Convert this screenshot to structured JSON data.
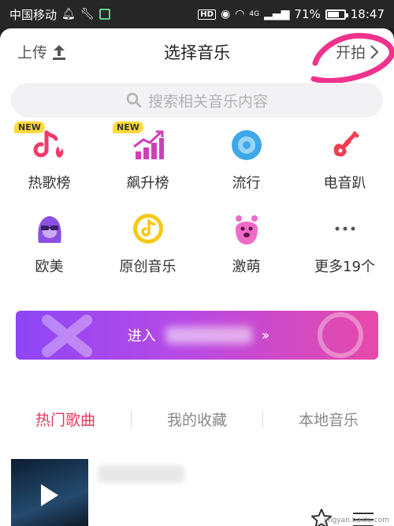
{
  "status_bar": {
    "carrier": "中国移动",
    "network": "4G",
    "battery": "71%",
    "battery_level": 0.71,
    "time": "18:47",
    "hd": "HD"
  },
  "header": {
    "upload_label": "上传",
    "title": "选择音乐",
    "start_label": "开拍"
  },
  "search": {
    "placeholder": "搜索相关音乐内容"
  },
  "categories": [
    {
      "label": "热歌榜",
      "icon": "hot-chart-icon",
      "badge": "NEW"
    },
    {
      "label": "飙升榜",
      "icon": "rising-chart-icon",
      "badge": "NEW"
    },
    {
      "label": "流行",
      "icon": "disc-icon",
      "badge": ""
    },
    {
      "label": "电音趴",
      "icon": "guitar-icon",
      "badge": ""
    },
    {
      "label": "欧美",
      "icon": "avatar-sunglasses-icon",
      "badge": ""
    },
    {
      "label": "原创音乐",
      "icon": "tiktok-note-icon",
      "badge": ""
    },
    {
      "label": "激萌",
      "icon": "cute-creature-icon",
      "badge": ""
    },
    {
      "label": "更多19个",
      "icon": "more-dots-icon",
      "badge": ""
    }
  ],
  "banner": {
    "label": "进入"
  },
  "tabs": [
    {
      "label": "热门歌曲",
      "active": true
    },
    {
      "label": "我的收藏",
      "active": false
    },
    {
      "label": "本地音乐",
      "active": false
    }
  ],
  "watermark": "jingyan.baidu.com",
  "colors": {
    "accent_pink": "#e5375d",
    "banner_start": "#8e46f5",
    "banner_end": "#e64aa8",
    "annotation": "#f0328c"
  }
}
